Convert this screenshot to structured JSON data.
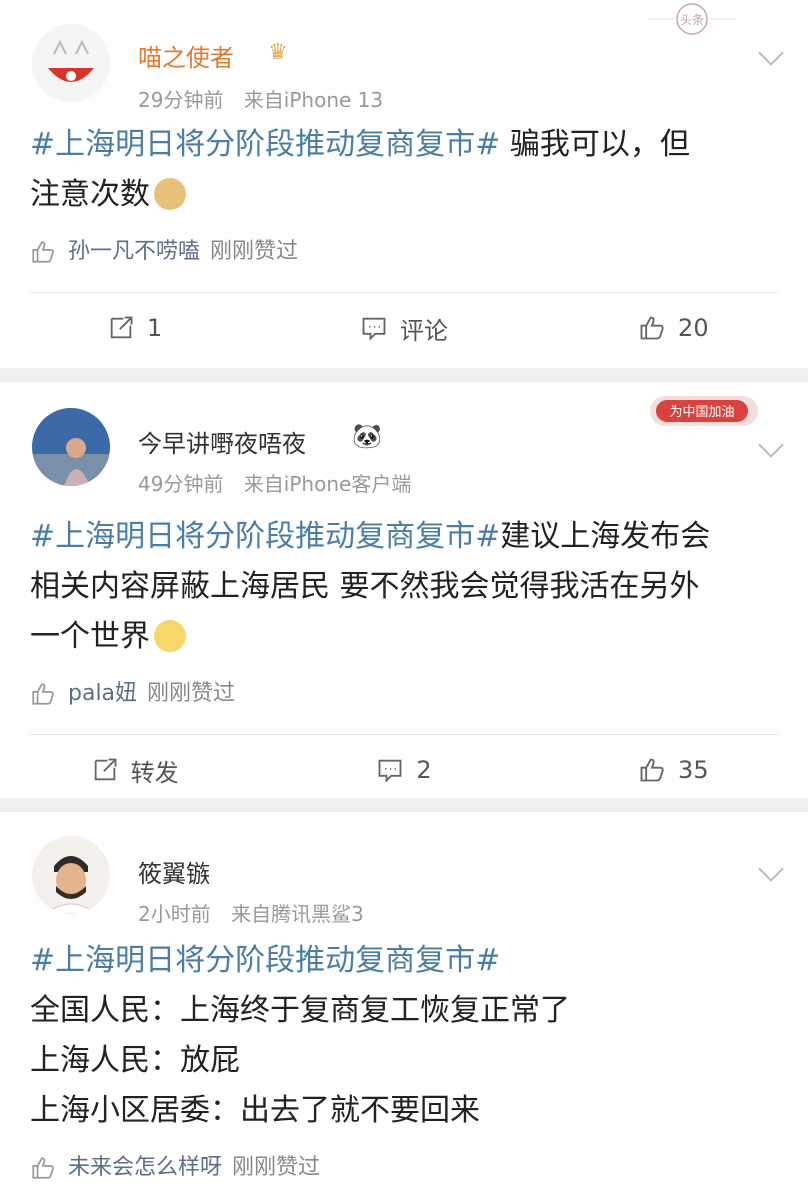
{
  "posts": [
    {
      "username": "喵之使者",
      "time": "29分钟前",
      "source": "来自iPhone 13",
      "topic": "#上海明日将分阶段推动复商复市#",
      "line1": " 骗我可以，但",
      "line2": "注意次数",
      "liked_by": "孙一凡不唠嗑",
      "liked_suffix": "刚刚赞过",
      "repost": "1",
      "comment": "评论",
      "like": "20",
      "badge_text": "头条"
    },
    {
      "username": "今早讲嘢夜唔夜",
      "time": "49分钟前",
      "source": "来自iPhone客户端",
      "topic": "#上海明日将分阶段推动复商复市#",
      "line1": "建议上海发布会",
      "line2": "相关内容屏蔽上海居民 要不然我会觉得我活在另外",
      "line3": "一个世界",
      "liked_by": "pala妞",
      "liked_suffix": "刚刚赞过",
      "repost": "转发",
      "comment": "2",
      "like": "35",
      "badge_text": "为中国加油"
    },
    {
      "username": "筱翼镞",
      "time": "2小时前",
      "source": "来自腾讯黑鲨3",
      "topic": "#上海明日将分阶段推动复商复市#",
      "line1": "全国人民：上海终于复商复工恢复正常了",
      "line2": "上海人民：放屁",
      "line3": "上海小区居委：出去了就不要回来",
      "liked_by": "未来会怎么样呀",
      "liked_suffix": "刚刚赞过"
    }
  ],
  "colors": {
    "topic": "#4a7ea8",
    "vip_name": "#e07a2e",
    "meta": "#999999"
  }
}
